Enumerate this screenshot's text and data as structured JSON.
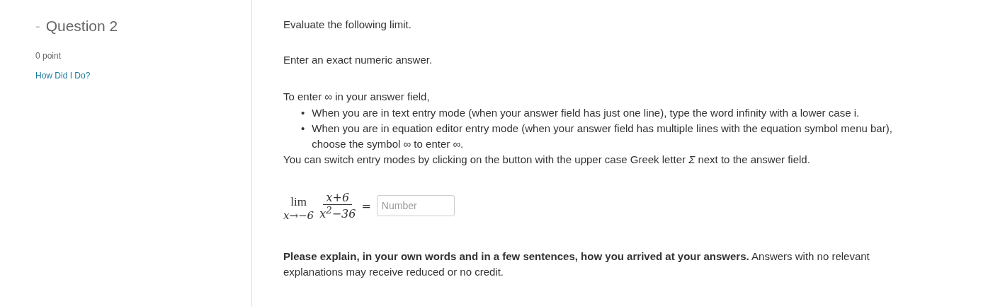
{
  "question": {
    "collapse_icon": "-",
    "title": "Question 2",
    "points": "0 point",
    "link": "How Did I Do?"
  },
  "body": {
    "prompt": "Evaluate the following limit.",
    "instruction": "Enter an exact numeric answer.",
    "intro": "To enter ∞ in your answer field,",
    "bullet_marker": "•",
    "bullets": [
      "When you are in text entry mode (when your answer field has just one line), type the word infinity with a lower case i.",
      "When you are in equation editor entry mode (when your answer field has multiple lines with the equation symbol menu bar), choose the symbol ∞ to enter ∞."
    ],
    "switch_note": "You can switch entry modes by clicking on the button with the upper case Greek letter *Σ* next to the answer field.",
    "formula": {
      "operator": "lim",
      "subscript": "x→−6",
      "numerator": "x+6",
      "denominator": "x$^{2}$−36",
      "equals": "="
    },
    "answer": {
      "placeholder": "Number"
    },
    "explain": "**Please explain, in your own words and in a few sentences, how you arrived at your answers.** Answers with no relevant explanations may receive reduced or no credit."
  }
}
